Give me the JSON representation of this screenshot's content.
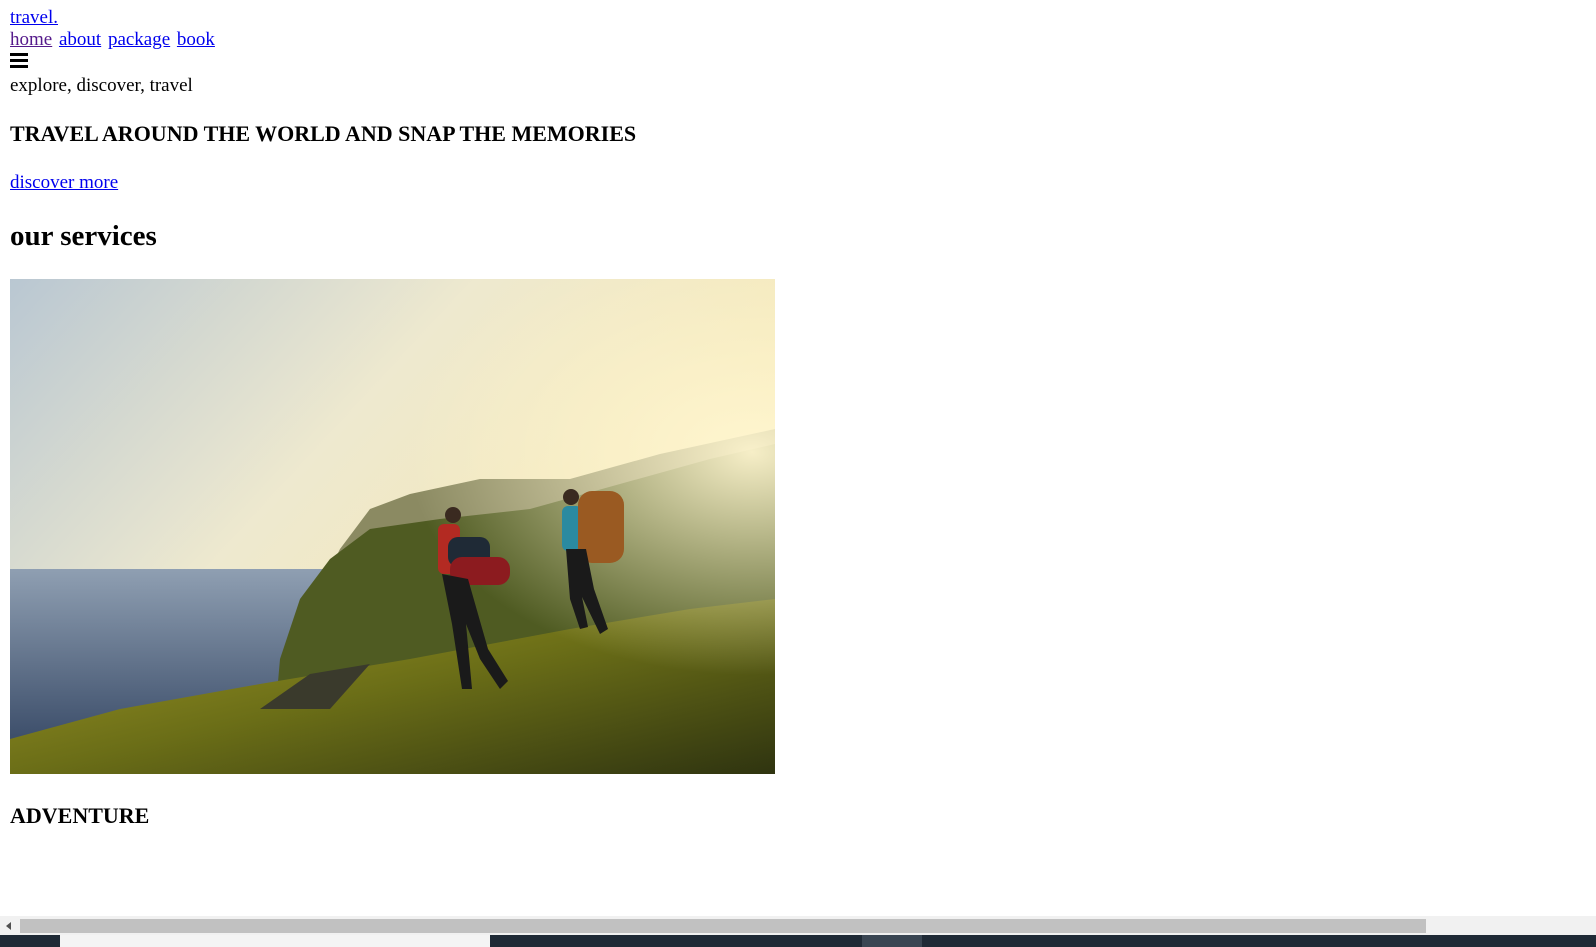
{
  "header": {
    "logo": "travel.",
    "nav": [
      {
        "label": "home"
      },
      {
        "label": "about"
      },
      {
        "label": "package"
      },
      {
        "label": "book"
      }
    ],
    "menu_icon": "hamburger-menu-icon"
  },
  "hero": {
    "tagline": "explore, discover, travel",
    "title": "TRAVEL AROUND THE WORLD AND SNAP THE MEMORIES",
    "cta": "discover more"
  },
  "services": {
    "heading": "our services",
    "items": [
      {
        "title": "ADVENTURE"
      }
    ]
  },
  "colors": {
    "link": "#0000ee",
    "visited_link": "#551a8b",
    "scrollbar_thumb": "#c1c1c1",
    "taskbar": "#1f2a36"
  }
}
